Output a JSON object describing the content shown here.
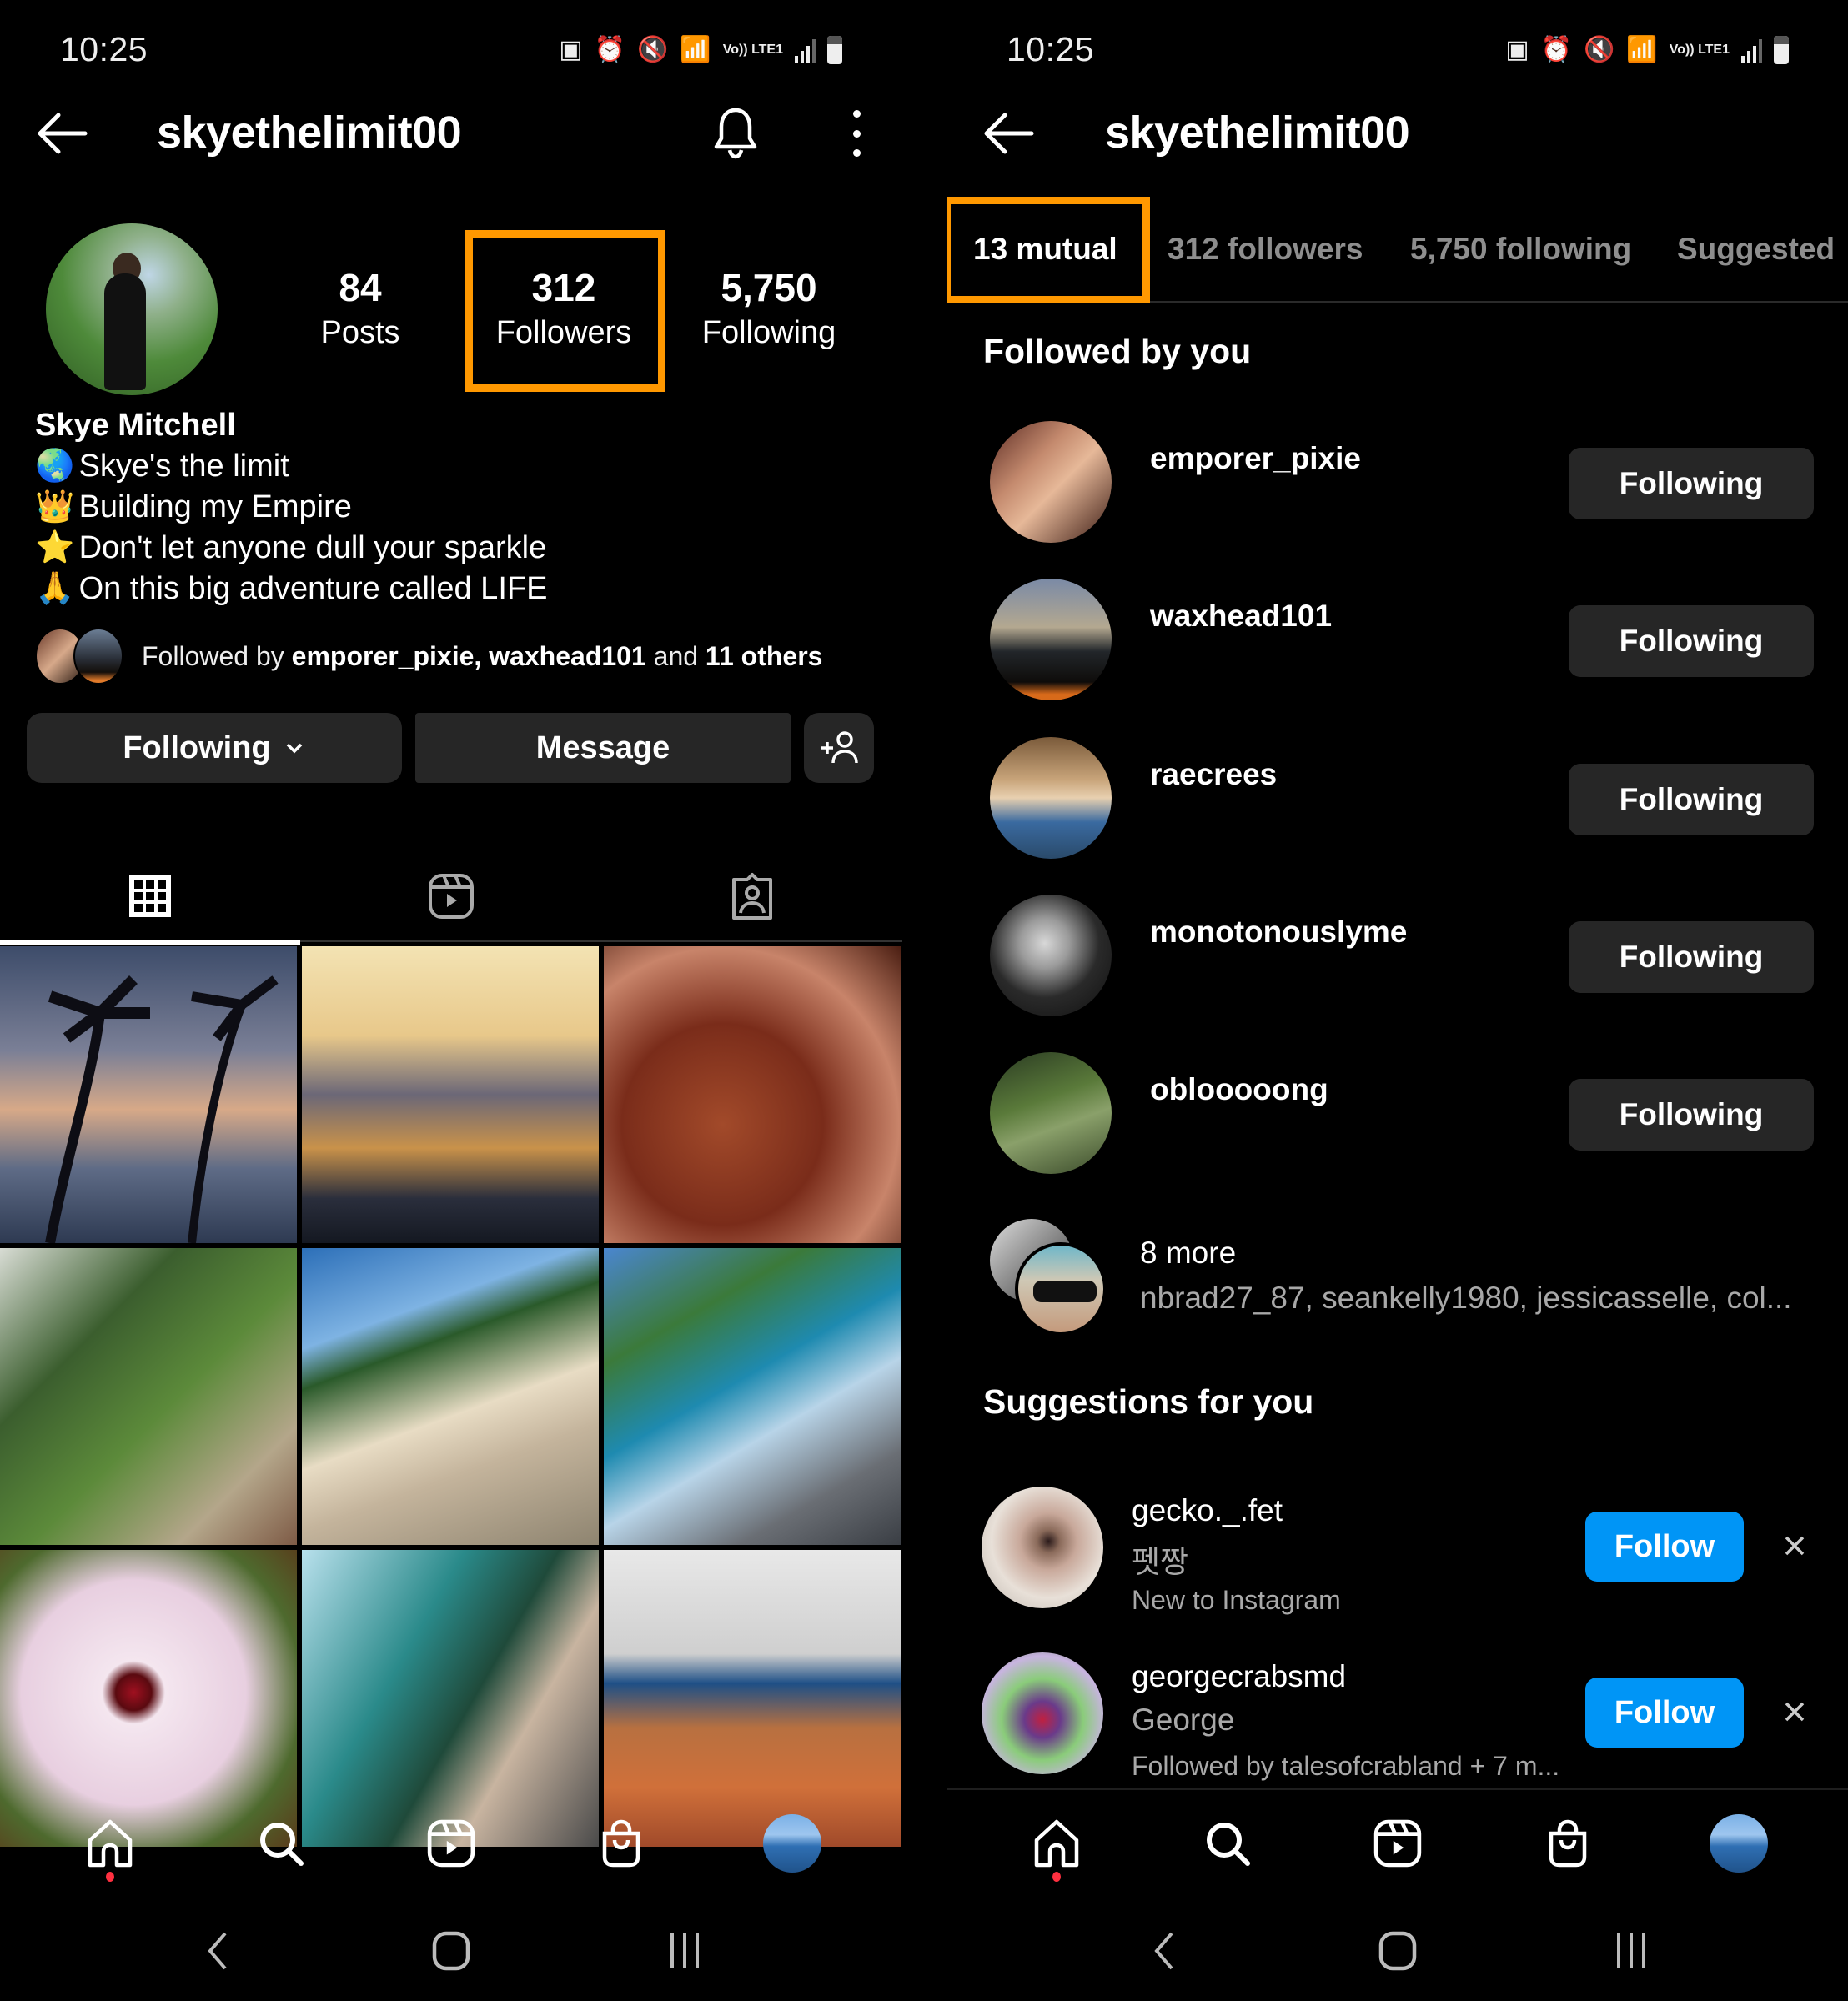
{
  "left": {
    "status_bar": {
      "time": "10:25",
      "network": "Vo)) LTE1"
    },
    "header": {
      "username": "skyethelimit00"
    },
    "profile": {
      "display_name": "Skye Mitchell",
      "stats": [
        {
          "value": "84",
          "label": "Posts"
        },
        {
          "value": "312",
          "label": "Followers"
        },
        {
          "value": "5,750",
          "label": "Following"
        }
      ],
      "bio": [
        {
          "emoji": "🌏",
          "text": "Skye's the limit"
        },
        {
          "emoji": "👑",
          "text": "Building my Empire"
        },
        {
          "emoji": "⭐",
          "text": "Don't let anyone dull your sparkle"
        },
        {
          "emoji": "🙏",
          "text": "On this big adventure called LIFE"
        }
      ],
      "followed_by": {
        "prefix": "Followed by",
        "user1": "emporer_pixie,",
        "user2": "waxhead101",
        "and": "and",
        "others": "11 others"
      }
    },
    "actions": {
      "following_label": "Following",
      "message_label": "Message"
    },
    "grid_tabs": [
      "posts-grid",
      "reels",
      "tagged"
    ],
    "highlight_color": "#ff9800"
  },
  "right": {
    "status_bar": {
      "time": "10:25",
      "network": "Vo)) LTE1"
    },
    "header": {
      "username": "skyethelimit00"
    },
    "tabs": [
      {
        "label": "13 mutual",
        "active": true
      },
      {
        "label": "312 followers",
        "active": false
      },
      {
        "label": "5,750 following",
        "active": false
      },
      {
        "label": "Suggested",
        "active": false
      }
    ],
    "followed_by_you": {
      "heading": "Followed by you",
      "users": [
        {
          "username": "emporer_pixie",
          "button": "Following"
        },
        {
          "username": "waxhead101",
          "button": "Following"
        },
        {
          "username": "raecrees",
          "button": "Following"
        },
        {
          "username": "monotonouslyme",
          "button": "Following"
        },
        {
          "username": "oblooooong",
          "button": "Following"
        }
      ],
      "more": {
        "count_label": "8 more",
        "names": "nbrad27_87, seankelly1980, jessicasselle, col..."
      }
    },
    "suggestions": {
      "heading": "Suggestions for you",
      "users": [
        {
          "username": "gecko._.fet",
          "name": "펫짱",
          "context": "New to Instagram",
          "button": "Follow"
        },
        {
          "username": "georgecrabsmd",
          "name": "George",
          "context": "Followed by talesofcrabland + 7 m...",
          "button": "Follow"
        }
      ]
    },
    "follow_color": "#0095f6"
  }
}
